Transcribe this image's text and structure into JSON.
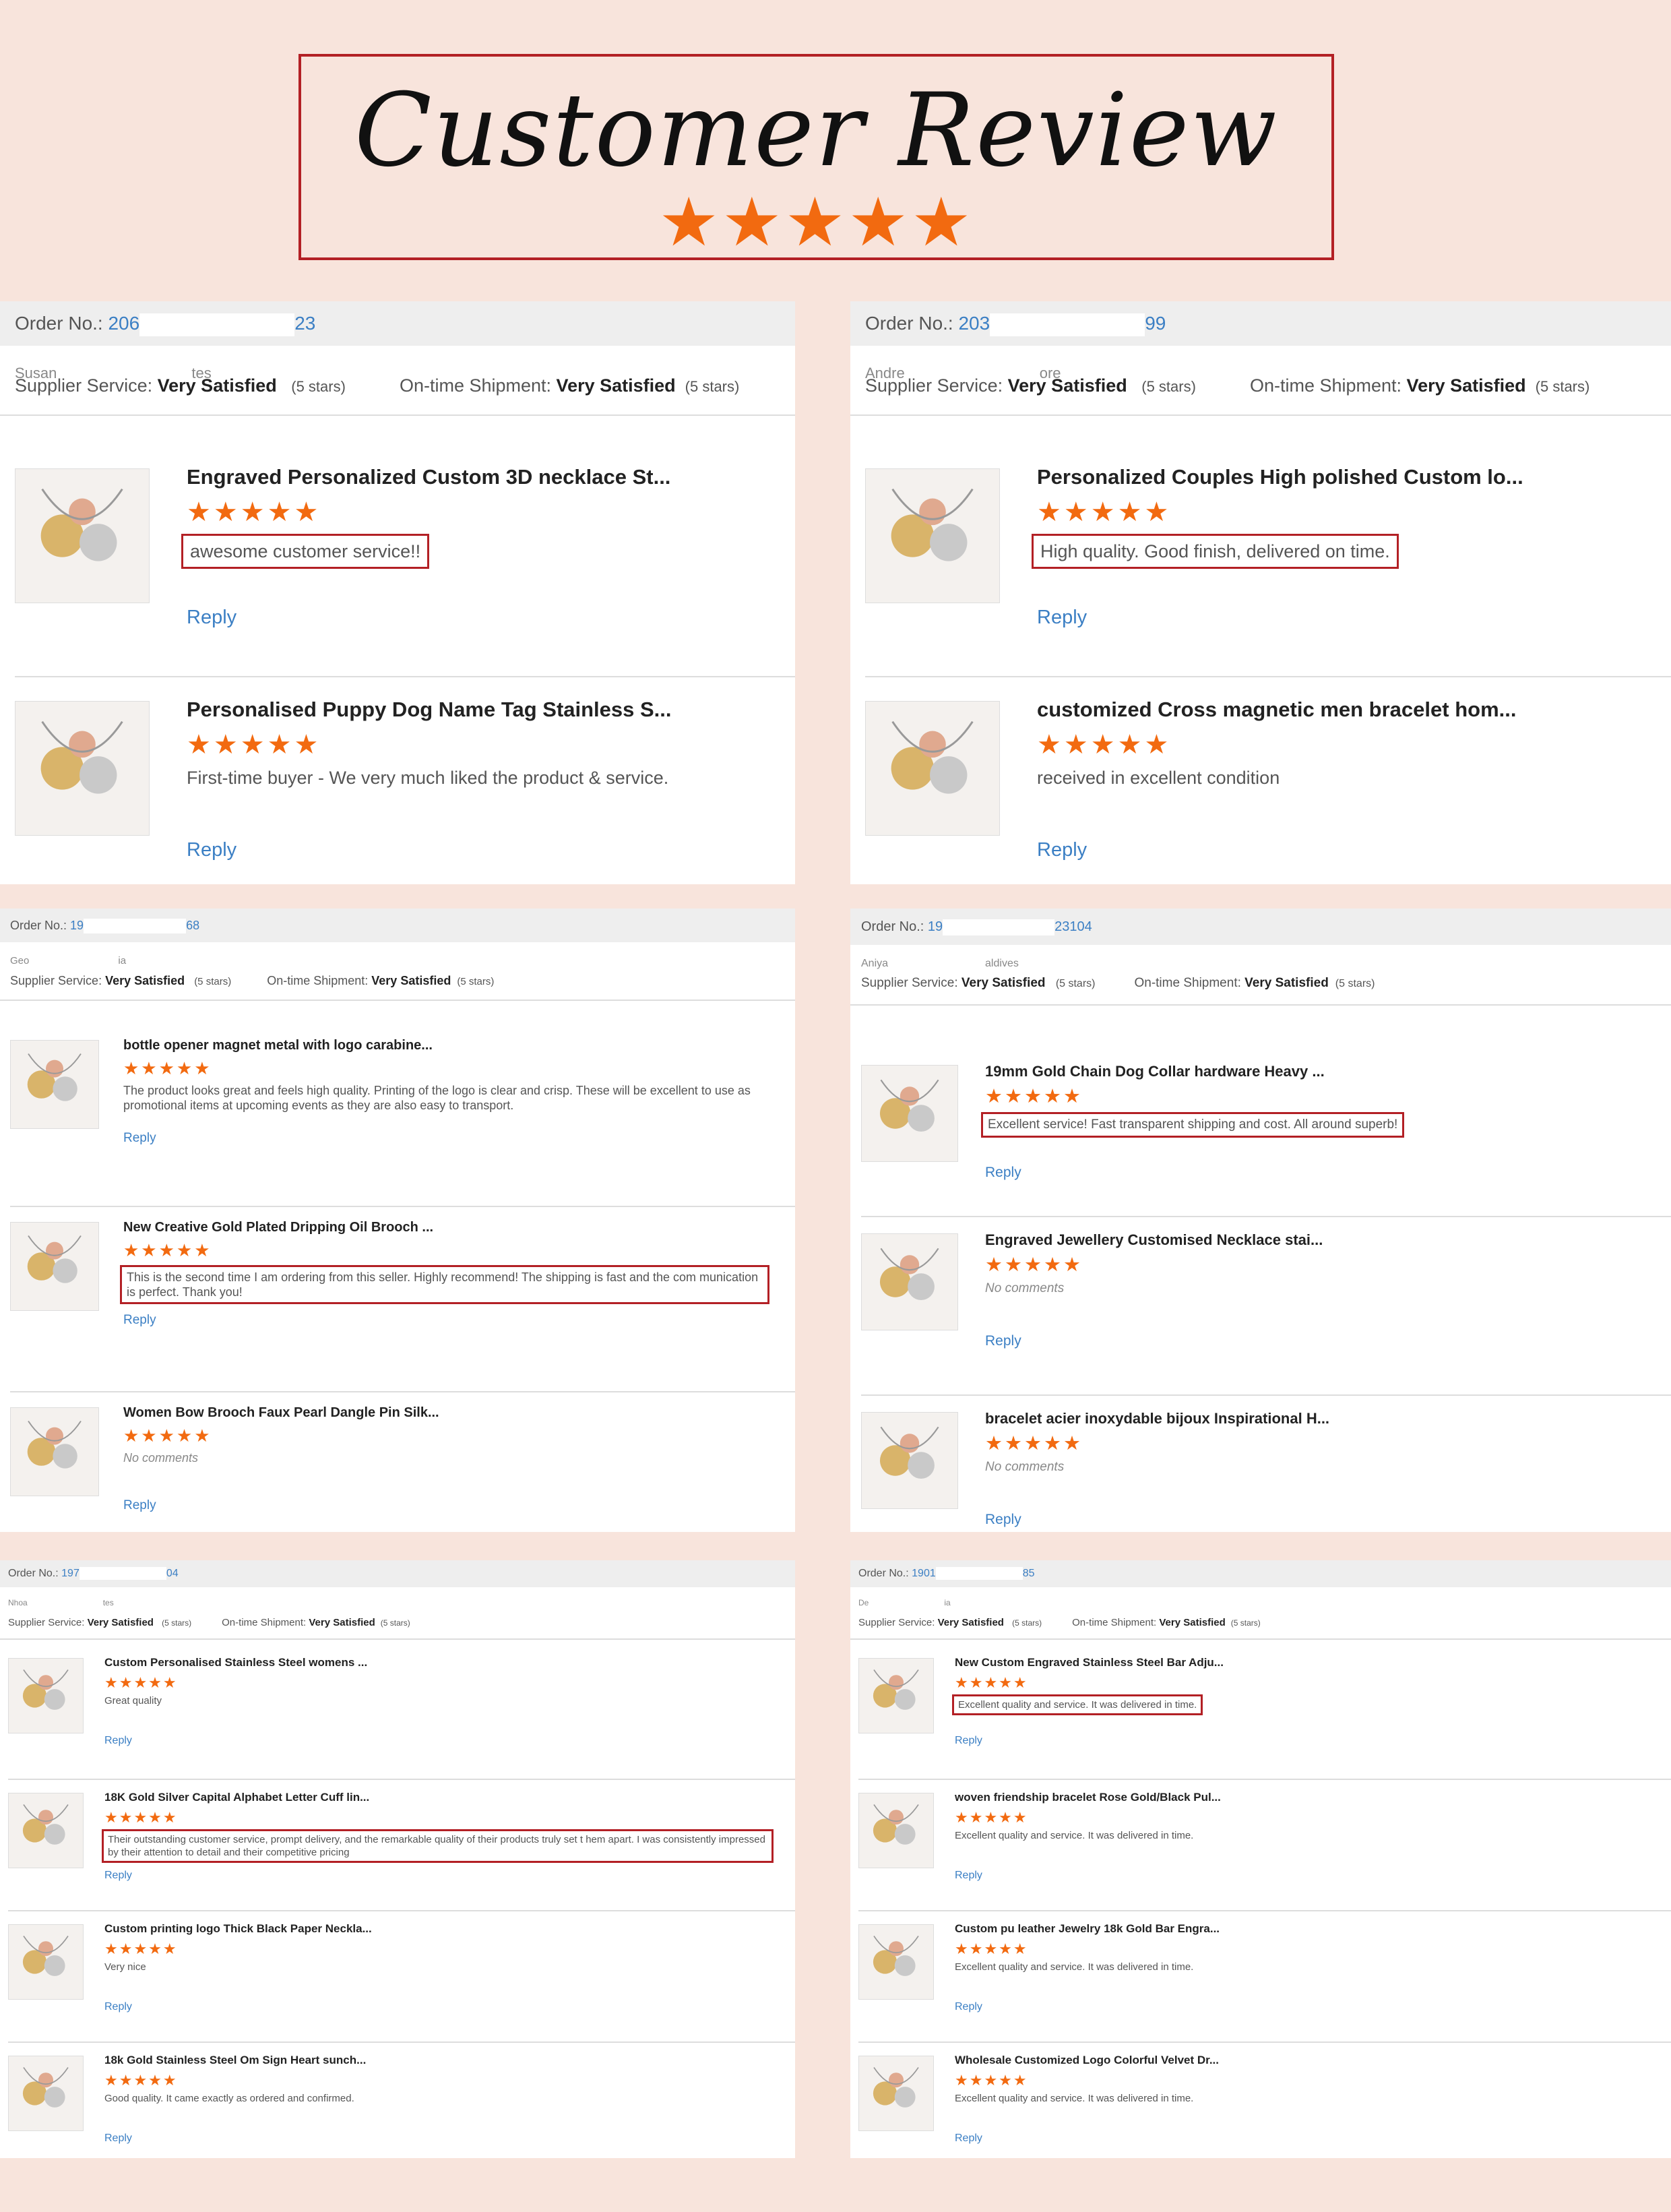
{
  "header": {
    "title": "Customer Review",
    "stars": "★★★★★"
  },
  "colors": {
    "accent": "#f26a10",
    "highlight_border": "#b32025",
    "link": "#3b7fc4",
    "background": "#f8e4dc"
  },
  "labels": {
    "order_no": "Order No.:",
    "supplier_service": "Supplier Service:",
    "ontime_shipment": "On-time Shipment:",
    "very_satisfied": "Very Satisfied",
    "five_stars": "(5 stars)",
    "reply": "Reply",
    "stars": "★★★★★"
  },
  "panels": [
    {
      "order_prefix": "206",
      "order_suffix": "23",
      "buyer_a": "Susan",
      "buyer_b": "tes",
      "items": [
        {
          "title": "Engraved Personalized Custom 3D necklace St...",
          "comment": "awesome customer service!!",
          "highlighted": true,
          "thumb": "necklace-thumbnail"
        },
        {
          "title": "Personalised Puppy Dog Name Tag Stainless S...",
          "comment": "First-time buyer - We very much liked the product & service.",
          "highlighted": false,
          "thumb": "dog-tag-thumbnail"
        }
      ]
    },
    {
      "order_prefix": "203",
      "order_suffix": "99",
      "buyer_a": "Andre",
      "buyer_b": "ore",
      "items": [
        {
          "title": "Personalized Couples High polished Custom lo...",
          "comment": "High quality. Good finish, delivered on time.",
          "highlighted": true,
          "thumb": "pendant-thumbnail"
        },
        {
          "title": "customized Cross magnetic men bracelet hom...",
          "comment": "received in excellent condition",
          "highlighted": false,
          "thumb": "bracelet-thumbnail"
        }
      ]
    },
    {
      "order_prefix": "19",
      "order_suffix": "68",
      "buyer_a": "Geo",
      "buyer_b": "ia",
      "items": [
        {
          "title": "bottle opener magnet metal with logo carabine...",
          "comment": "The product looks great and feels high quality. Printing of the logo is clear and crisp. These will be excellent to use as promotional items at upcoming events as they are also easy to transport.",
          "highlighted": false,
          "thumb": "bottle-opener-thumbnail"
        },
        {
          "title": "New Creative Gold Plated Dripping Oil Brooch ...",
          "comment": "This is the second time I am ordering from this seller. Highly recommend! The shipping is fast and the com munication is perfect. Thank you!",
          "highlighted": true,
          "thumb": "brooch-thumbnail"
        },
        {
          "title": "Women Bow Brooch Faux Pearl Dangle Pin Silk...",
          "comment": "No comments",
          "highlighted": false,
          "italic": true,
          "thumb": "bow-brooch-thumbnail"
        }
      ]
    },
    {
      "order_prefix": "19",
      "order_suffix": "23104",
      "buyer_a": "Aniya",
      "buyer_b": "aldives",
      "items": [
        {
          "title": "19mm Gold Chain Dog Collar hardware Heavy ...",
          "comment": "Excellent service! Fast transparent shipping and cost. All around superb!",
          "highlighted": true,
          "thumb": "dog-collar-thumbnail"
        },
        {
          "title": "Engraved Jewellery Customised Necklace stai...",
          "comment": "No comments",
          "highlighted": false,
          "italic": true,
          "thumb": "engraved-necklace-thumbnail"
        },
        {
          "title": "bracelet acier inoxydable bijoux Inspirational H...",
          "comment": "No comments",
          "highlighted": false,
          "italic": true,
          "thumb": "cuff-bracelet-thumbnail"
        }
      ]
    },
    {
      "order_prefix": "197",
      "order_suffix": "04",
      "buyer_a": "Nhoa",
      "buyer_b": "tes",
      "items": [
        {
          "title": "Custom Personalised Stainless Steel womens ...",
          "comment": "Great quality",
          "highlighted": false,
          "thumb": "bar-necklace-thumbnail"
        },
        {
          "title": "18K Gold Silver Capital Alphabet Letter Cuff lin...",
          "comment": "Their outstanding customer service, prompt delivery, and the remarkable quality of their products truly set t hem apart. I was consistently impressed by their attention to detail and their competitive pricing",
          "highlighted": true,
          "thumb": "cufflinks-thumbnail"
        },
        {
          "title": "Custom printing logo Thick Black Paper Neckla...",
          "comment": "Very nice",
          "highlighted": false,
          "thumb": "gift-box-thumbnail"
        },
        {
          "title": "18k Gold Stainless Steel Om Sign Heart sunch...",
          "comment": "Good quality. It came exactly as ordered and confirmed.",
          "highlighted": false,
          "thumb": "charms-thumbnail"
        }
      ]
    },
    {
      "order_prefix": "1901",
      "order_suffix": "85",
      "buyer_a": "De",
      "buyer_b": "ia",
      "items": [
        {
          "title": "New Custom Engraved Stainless Steel Bar Adju...",
          "comment": "Excellent quality and service. It was delivered in time.",
          "highlighted": true,
          "thumb": "bar-bracelet-thumbnail"
        },
        {
          "title": "woven friendship bracelet Rose Gold/Black Pul...",
          "comment": "Excellent quality and service. It was delivered in time.",
          "highlighted": false,
          "thumb": "friendship-bracelet-thumbnail"
        },
        {
          "title": "Custom pu leather Jewelry 18k Gold Bar Engra...",
          "comment": "Excellent quality and service. It was delivered in time.",
          "highlighted": false,
          "thumb": "leather-bracelet-thumbnail"
        },
        {
          "title": "Wholesale Customized Logo Colorful Velvet Dr...",
          "comment": "Excellent quality and service. It was delivered in time.",
          "highlighted": false,
          "thumb": "velvet-pouch-thumbnail"
        }
      ]
    }
  ]
}
